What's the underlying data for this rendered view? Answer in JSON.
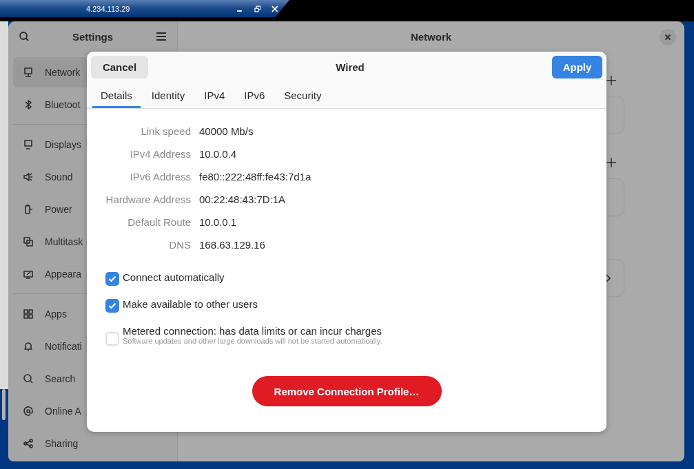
{
  "remote_toolbar": {
    "address": "4.234.113.29"
  },
  "sidebar": {
    "title": "Settings",
    "groups": [
      [
        {
          "label": "Network",
          "selected": true
        },
        {
          "label": "Bluetoot",
          "selected": false
        }
      ],
      [
        {
          "label": "Displays",
          "selected": false
        },
        {
          "label": "Sound",
          "selected": false
        },
        {
          "label": "Power",
          "selected": false
        },
        {
          "label": "Multitask",
          "selected": false
        },
        {
          "label": "Appeara",
          "selected": false
        }
      ],
      [
        {
          "label": "Apps",
          "selected": false
        },
        {
          "label": "Notificati",
          "selected": false
        },
        {
          "label": "Search",
          "selected": false
        },
        {
          "label": "Online A",
          "selected": false
        },
        {
          "label": "Sharing",
          "selected": false
        }
      ]
    ]
  },
  "main": {
    "title": "Network"
  },
  "dialog": {
    "title": "Wired",
    "cancel": "Cancel",
    "apply": "Apply",
    "tabs": [
      {
        "label": "Details",
        "selected": true
      },
      {
        "label": "Identity",
        "selected": false
      },
      {
        "label": "IPv4",
        "selected": false
      },
      {
        "label": "IPv6",
        "selected": false
      },
      {
        "label": "Security",
        "selected": false
      }
    ],
    "details": [
      {
        "label": "Link speed",
        "value": "40000 Mb/s"
      },
      {
        "label": "IPv4 Address",
        "value": "10.0.0.4"
      },
      {
        "label": "IPv6 Address",
        "value": "fe80::222:48ff:fe43:7d1a"
      },
      {
        "label": "Hardware Address",
        "value": "00:22:48:43:7D:1A"
      },
      {
        "label": "Default Route",
        "value": "10.0.0.1"
      },
      {
        "label": "DNS",
        "value": "168.63.129.16"
      }
    ],
    "options": [
      {
        "label": "Connect automatically",
        "checked": true
      },
      {
        "label": "Make available to other users",
        "checked": true
      },
      {
        "label": "Metered connection: has data limits or can incur charges",
        "hint": "Software updates and other large downloads will not be started automatically.",
        "checked": false
      }
    ],
    "remove": "Remove Connection Profile…"
  }
}
